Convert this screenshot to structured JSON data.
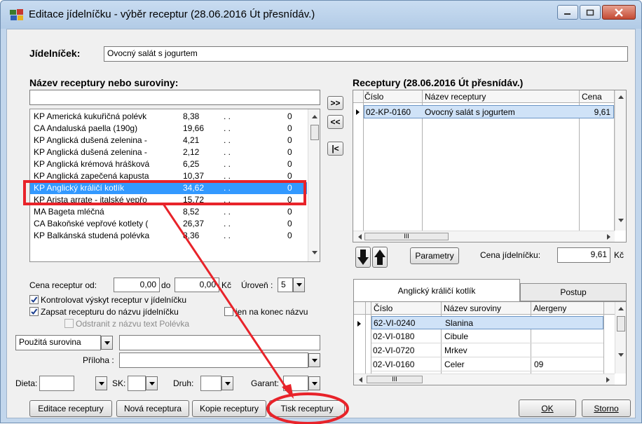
{
  "window": {
    "title": "Editace jídelníčku - výběr receptur (28.06.2016 Út přesnídáv.)"
  },
  "menu_header": {
    "label": "Jídelníček:",
    "value": "Ovocný salát s jogurtem"
  },
  "left_list": {
    "heading": "Název receptury nebo suroviny:",
    "search_value": "",
    "rows": [
      {
        "name": "KP Americká kukuřičná polévk",
        "price": "8,38",
        "dots": ". .",
        "count": "0"
      },
      {
        "name": "CA Andaluská paella  (190g)",
        "price": "19,66",
        "dots": ". .",
        "count": "0"
      },
      {
        "name": "KP Anglická dušená zelenina -",
        "price": "4,21",
        "dots": ". .",
        "count": "0"
      },
      {
        "name": "KP Anglická dušená zelenina -",
        "price": "2,12",
        "dots": ". .",
        "count": "0"
      },
      {
        "name": "KP Anglická krémová hrášková",
        "price": "6,25",
        "dots": ". .",
        "count": "0"
      },
      {
        "name": "KP Anglická zapečená kapusta",
        "price": "10,37",
        "dots": ". .",
        "count": "0"
      },
      {
        "name": "KP Anglický králičí kotlík",
        "price": "34,62",
        "dots": ". .",
        "count": "0"
      },
      {
        "name": "KP Arista arrate - italské vepřo",
        "price": "15,72",
        "dots": ". .",
        "count": "0"
      },
      {
        "name": "MA Bageta mléčná",
        "price": "8,52",
        "dots": ". .",
        "count": "0"
      },
      {
        "name": "CA Bakoňské vepřové kotlety (",
        "price": "26,37",
        "dots": ". .",
        "count": "0"
      },
      {
        "name": "KP Balkánská studená polévka",
        "price": "8,36",
        "dots": ". .",
        "count": "0"
      }
    ],
    "selected_index": 6
  },
  "transfer_buttons": {
    "add": ">>",
    "remove": "<<",
    "first": "|<"
  },
  "right_grid": {
    "heading": "Receptury (28.06.2016 Út přesnídáv.)",
    "columns": [
      "Číslo",
      "Název receptury",
      "Cena"
    ],
    "rows": [
      {
        "code": "02-KP-0160",
        "name": "Ovocný salát s jogurtem",
        "price": "9,61"
      }
    ],
    "scroll_marker": "III"
  },
  "parametry_button": "Parametry",
  "cena_jidelnicku": {
    "label": "Cena jídelníčku:",
    "value": "9,61",
    "unit": "Kč"
  },
  "filters": {
    "cena_od_label": "Cena receptur od:",
    "cena_od_value": "0,00",
    "do_label": "do",
    "cena_do_value": "0,00",
    "kc_label": "Kč",
    "uroven_label": "Úroveň :",
    "uroven_value": "5",
    "chk_kontrolovat": "Kontrolovat výskyt receptur v jídelníčku",
    "chk_zapsat": "Zapsat recepturu do názvu jídelníčku",
    "chk_jen_konec": "jen na konec názvu",
    "chk_odstranit": "Odstranit z názvu text Polévka",
    "pouzita_surovina": "Použitá surovina",
    "priloha_label": "Příloha :",
    "dieta_label": "Dieta:",
    "sk_label": "SK:",
    "druh_label": "Druh:",
    "garant_label": "Garant:"
  },
  "tabs": {
    "active": "Anglický králičí kotlík",
    "second": "Postup"
  },
  "ingredients_grid": {
    "columns": [
      "Číslo",
      "Název suroviny",
      "Alergeny"
    ],
    "rows": [
      {
        "code": "62-VI-0240",
        "name": "Slanina",
        "allergen": ""
      },
      {
        "code": "02-VI-0180",
        "name": "Cibule",
        "allergen": ""
      },
      {
        "code": "02-VI-0720",
        "name": "Mrkev",
        "allergen": ""
      },
      {
        "code": "02-VI-0160",
        "name": "Celer",
        "allergen": "09"
      }
    ],
    "scroll_marker": "III"
  },
  "bottom_buttons": {
    "editace": "Editace receptury",
    "nova": "Nová receptura",
    "kopie": "Kopie receptury",
    "tisk": "Tisk receptury",
    "ok": "OK",
    "storno": "Storno"
  },
  "annotation_color": "#e8232a"
}
